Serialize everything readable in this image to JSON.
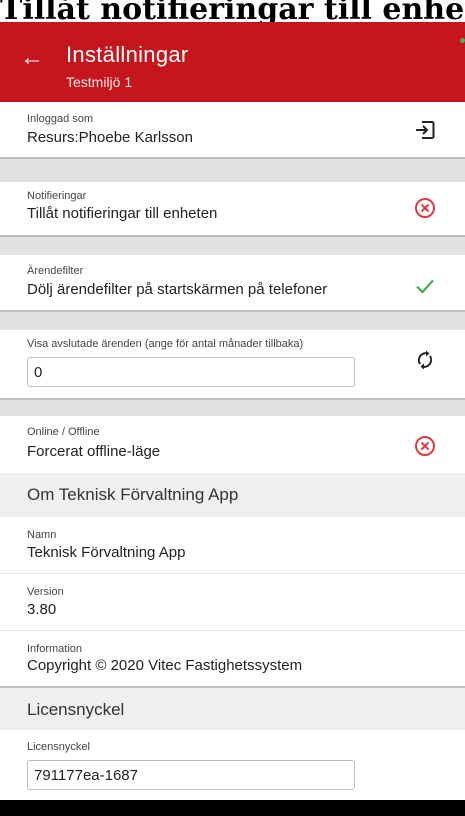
{
  "doc_heading": "Tillåt notifieringar till enheten:",
  "appbar": {
    "title": "Inställningar",
    "subtitle": "Testmiljö 1",
    "back_icon": "arrow-left-icon",
    "color": "#c4161c"
  },
  "login": {
    "label": "Inloggad som",
    "value": "Resurs:Phoebe Karlsson",
    "icon": "logout-icon"
  },
  "notifications": {
    "label": "Notifieringar",
    "value": "Tillåt notifieringar till enheten",
    "icon": "cancel-circle-icon",
    "state": "off"
  },
  "case_filter": {
    "label": "Ärendefilter",
    "value": "Dölj ärendefilter på startskärmen på telefoner",
    "icon": "check-icon",
    "state": "on"
  },
  "closed_cases": {
    "label": "Visa avslutade ärenden (ange för antal månader tillbaka)",
    "input_value": "0",
    "icon": "refresh-icon"
  },
  "online_offline": {
    "label": "Online / Offline",
    "value": "Forcerat offline-läge",
    "icon": "cancel-circle-icon",
    "state": "off"
  },
  "about": {
    "header": "Om Teknisk Förvaltning App",
    "name_label": "Namn",
    "name_value": "Teknisk Förvaltning App",
    "version_label": "Version",
    "version_value": "3.80",
    "info_label": "Information",
    "info_value": "Copyright © 2020 Vitec Fastighetssystem"
  },
  "license": {
    "header": "Licensnyckel",
    "label": "Licensnyckel",
    "input_value": "791177ea-1687"
  },
  "colors": {
    "accent_red": "#c4161c",
    "check_green": "#3fae4a",
    "cancel_red": "#e0393e"
  }
}
